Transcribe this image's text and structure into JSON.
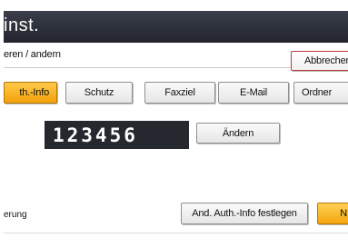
{
  "title_bar": {
    "title": "inst."
  },
  "header": {
    "breadcrumb": "eren / andern",
    "cancel_label": "Abbrechen"
  },
  "tabs": [
    {
      "label": "th.-Info",
      "active": true
    },
    {
      "label": "Schutz",
      "active": false
    },
    {
      "label": "Faxziel",
      "active": false
    },
    {
      "label": "E-Mail",
      "active": false
    },
    {
      "label": "Ordner",
      "active": false
    }
  ],
  "entry": {
    "number": "123456",
    "change_label": "Ändern"
  },
  "footer": {
    "label": "erung",
    "set_auth_label": "And. Auth.-Info festlegen",
    "next_label": "N"
  },
  "colors": {
    "title_bar": "#22252e",
    "active_tab": "#f2a20c",
    "number_box": "#262830",
    "cancel_border": "#c0393b"
  }
}
